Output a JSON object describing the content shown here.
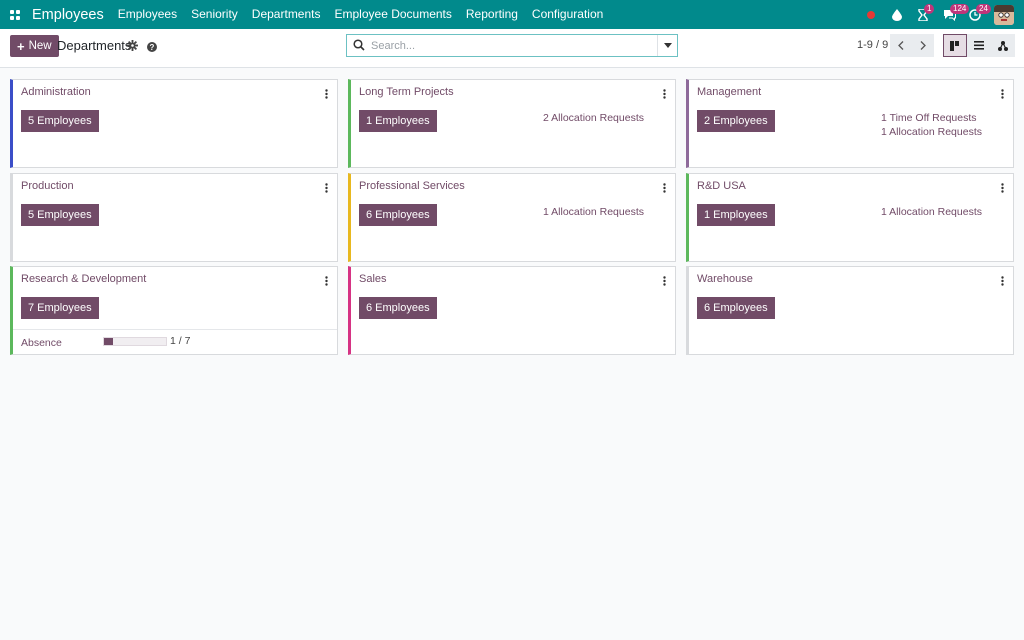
{
  "navbar": {
    "app_name": "Employees",
    "menu": [
      "Employees",
      "Seniority",
      "Departments",
      "Employee Documents",
      "Reporting",
      "Configuration"
    ],
    "badges": {
      "activities": "1",
      "messages": "124",
      "clock": "24"
    },
    "color": "#018a8c"
  },
  "control": {
    "new_label": "New",
    "title": "Departments",
    "search_placeholder": "Search...",
    "pager": "1-9 / 9"
  },
  "departments": [
    {
      "name": "Administration",
      "employees": "5 Employees",
      "requests": [],
      "color": "#3b4ec8"
    },
    {
      "name": "Long Term Projects",
      "employees": "1 Employees",
      "requests": [
        "2 Allocation Requests"
      ],
      "color": "#5cb85c"
    },
    {
      "name": "Management",
      "employees": "2 Employees",
      "requests": [
        "1 Time Off Requests",
        "1 Allocation Requests"
      ],
      "color": "#8e6a9a"
    },
    {
      "name": "Production",
      "employees": "5 Employees",
      "requests": [],
      "color": "#d8dadd"
    },
    {
      "name": "Professional Services",
      "employees": "6 Employees",
      "requests": [
        "1 Allocation Requests"
      ],
      "color": "#e8b81f"
    },
    {
      "name": "R&D USA",
      "employees": "1 Employees",
      "requests": [
        "1 Allocation Requests"
      ],
      "color": "#5cb85c"
    },
    {
      "name": "Research & Development",
      "employees": "7 Employees",
      "requests": [],
      "color": "#5cb85c",
      "footer": {
        "label": "Absence",
        "text": "1 / 7",
        "progress": 0.14
      }
    },
    {
      "name": "Sales",
      "employees": "6 Employees",
      "requests": [],
      "color": "#d63384"
    },
    {
      "name": "Warehouse",
      "employees": "6 Employees",
      "requests": [],
      "color": "#d8dadd"
    }
  ],
  "accent": "#714b67"
}
